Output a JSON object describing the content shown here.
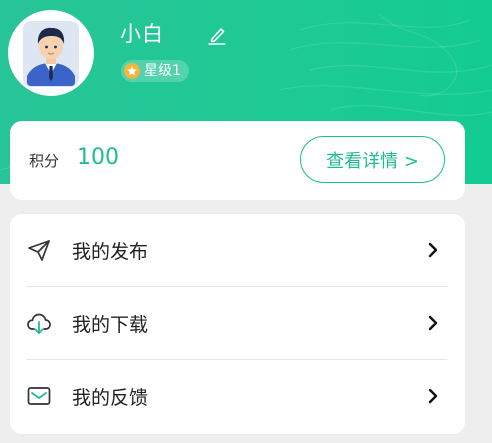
{
  "profile": {
    "username": "小白",
    "level_label": "星级1"
  },
  "points": {
    "label": "积分",
    "value": "100",
    "detail_button": "查看详情 >"
  },
  "menu": {
    "items": [
      {
        "label": "我的发布",
        "icon": "paper-plane-icon"
      },
      {
        "label": "我的下载",
        "icon": "cloud-download-icon"
      },
      {
        "label": "我的反馈",
        "icon": "envelope-icon"
      }
    ]
  },
  "colors": {
    "header_green": "#1fc994",
    "accent_green": "#1fbd8e",
    "star_gold": "#f3b63b",
    "background": "#eeeeee"
  }
}
